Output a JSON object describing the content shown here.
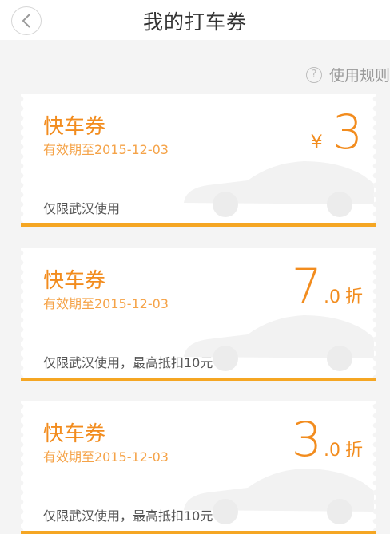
{
  "header": {
    "title": "我的打车券"
  },
  "rules_label": "使用规则",
  "coupons": [
    {
      "title": "快车券",
      "expiry": "有效期至2015-12-03",
      "value_prefix": "¥",
      "value_main": "3",
      "value_suffix": "",
      "value_unit": "",
      "note": "仅限武汉使用"
    },
    {
      "title": "快车券",
      "expiry": "有效期至2015-12-03",
      "value_prefix": "",
      "value_main": "7",
      "value_suffix": ".0",
      "value_unit": "折",
      "note": "仅限武汉使用，最高抵扣10元"
    },
    {
      "title": "快车券",
      "expiry": "有效期至2015-12-03",
      "value_prefix": "",
      "value_main": "3",
      "value_suffix": ".0",
      "value_unit": "折",
      "note": "仅限武汉使用，最高抵扣10元"
    }
  ],
  "colors": {
    "accent": "#f28c1e",
    "background": "#f4f4f4"
  }
}
